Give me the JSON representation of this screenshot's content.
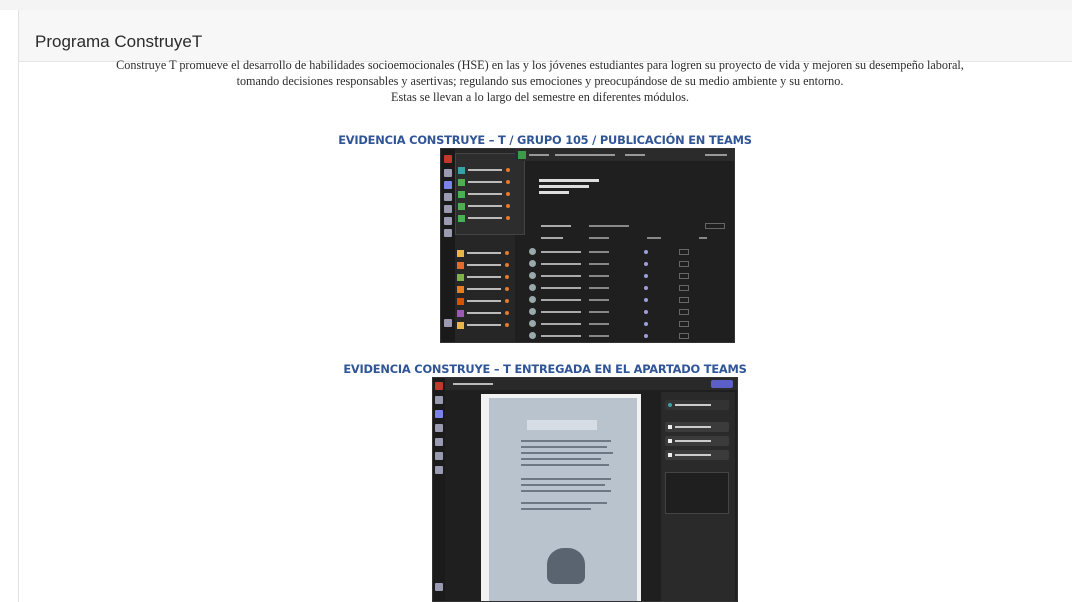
{
  "card": {
    "title": "Programa ConstruyeT"
  },
  "intro": {
    "line1": "Construye T promueve el desarrollo de habilidades socioemocionales (HSE) en las y los jóvenes estudiantes para logren su proyecto de vida y mejoren su desempeño laboral,",
    "line2": "tomando decisiones responsables y asertivas; regulando sus emociones y preocupándose de su medio ambiente y su entorno.",
    "line3": "Estas se llevan a lo largo del semestre en diferentes módulos."
  },
  "evidence": [
    {
      "caption": "EVIDENCIA CONSTRUYE – T / GRUPO 105 / PUBLICACIÓN EN TEAMS"
    },
    {
      "caption": "EVIDENCIA CONSTRUYE – T ENTREGADA EN EL APARTADO TEAMS"
    }
  ],
  "colors": {
    "caption": "#2f5597",
    "teams_accent": "#5b5fc7",
    "teams_dark": "#1f1f1f"
  }
}
